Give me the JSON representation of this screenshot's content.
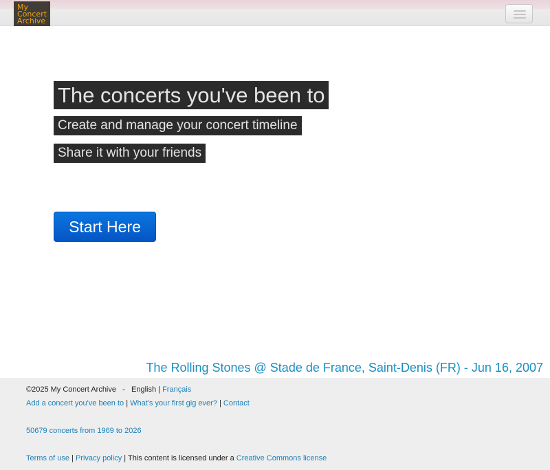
{
  "brand": {
    "logo_line1": "My",
    "logo_line2": "Concert",
    "logo_line3": "Archive"
  },
  "hero": {
    "title": "The concerts you've been to",
    "subtitle1": "Create and manage your concert timeline",
    "subtitle2": "Share it with your friends",
    "cta_label": "Start Here"
  },
  "featured_concert": "The Rolling Stones @ Stade de France, Saint-Denis (FR) - Jun 16, 2007",
  "footer": {
    "copyright": "©2025 My Concert Archive",
    "separator_dash": "-",
    "lang_current": "English",
    "lang_french": "Français",
    "link_add_concert": "Add a concert you've been to",
    "link_first_gig": "What's your first gig ever?",
    "link_contact": "Contact",
    "stats": "50679 concerts from 1969 to 2026",
    "link_terms": "Terms of use",
    "link_privacy": "Privacy policy",
    "license_text": "This content is licensed under a",
    "link_license": "Creative Commons license",
    "pipe": "|"
  },
  "colors": {
    "link": "#1a7fb8",
    "accent_button": "#0a76e0",
    "logo_text": "#f0a015",
    "hero_bg": "#2b2b2b"
  },
  "icons": {
    "menu": "hamburger-menu-icon"
  }
}
